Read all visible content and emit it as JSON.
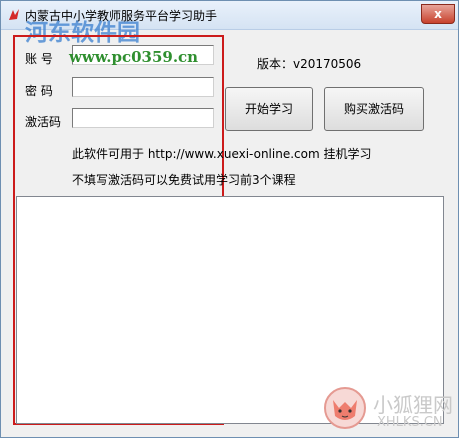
{
  "window": {
    "title": "内蒙古中小学教师服务平台学习助手",
    "close_label": "x"
  },
  "form": {
    "account_label": "账  号",
    "password_label": "密  码",
    "activation_label": "激活码",
    "account_value": "",
    "password_value": "",
    "activation_value": ""
  },
  "version_text": "版本：v20170506",
  "buttons": {
    "start": "开始学习",
    "buy": "购买激活码"
  },
  "info": {
    "line1": "此软件可用于 http://www.xuexi-online.com 挂机学习",
    "line2": "不填写激活码可以免费试用学习前3个课程"
  },
  "log_text": "",
  "watermarks": {
    "site_name": "河东软件园",
    "site_url": "www.pc0359.cn",
    "fox_name": "小狐狸网",
    "fox_domain": "XHLKS.CN"
  },
  "colors": {
    "highlight_box": "#cc1b1b",
    "watermark_blue": "#3a7fcf",
    "watermark_green": "#2f8f2f"
  }
}
